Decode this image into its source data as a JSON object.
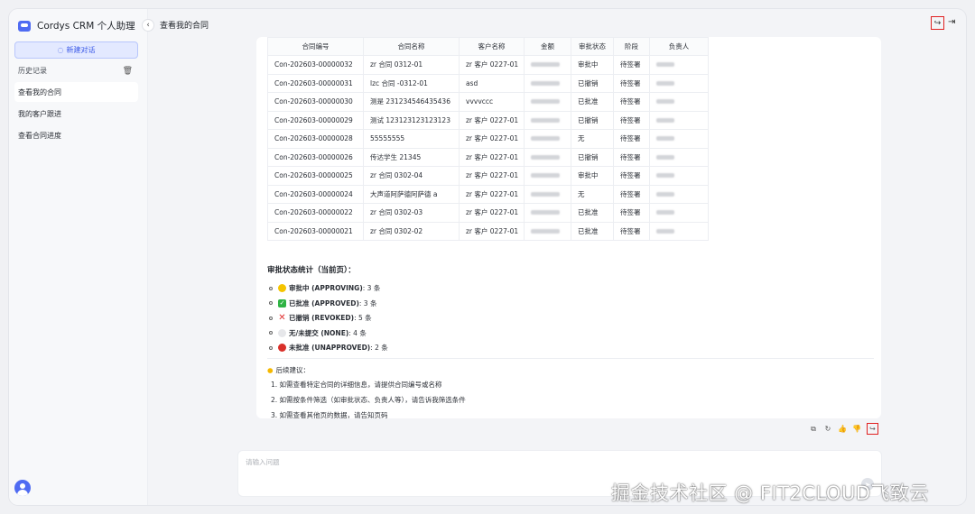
{
  "sidebar": {
    "app_name": "Cordys CRM 个人助理",
    "new_chat": "新建对话",
    "history_label": "历史记录",
    "items": [
      {
        "label": "查看我的合同",
        "active": true
      },
      {
        "label": "我的客户跟进",
        "active": false
      },
      {
        "label": "查看合同进度",
        "active": false
      }
    ]
  },
  "header": {
    "title": "查看我的合同"
  },
  "table": {
    "headers": [
      "合同编号",
      "合同名称",
      "客户名称",
      "金额",
      "审批状态",
      "阶段",
      "负责人"
    ],
    "rows": [
      [
        "Con-202603-00000032",
        "zr 合同 0312-01",
        "zr 客户 0227-01",
        "",
        "审批中",
        "待签署",
        ""
      ],
      [
        "Con-202603-00000031",
        "lzc 合同 -0312-01",
        "asd",
        "",
        "已撤销",
        "待签署",
        ""
      ],
      [
        "Con-202603-00000030",
        "测是 231234546435436",
        "vvvvccc",
        "",
        "已批准",
        "待签署",
        ""
      ],
      [
        "Con-202603-00000029",
        "测试 123123123123123",
        "zr 客户 0227-01",
        "",
        "已撤销",
        "待签署",
        ""
      ],
      [
        "Con-202603-00000028",
        "55555555",
        "zr 客户 0227-01",
        "",
        "无",
        "待签署",
        ""
      ],
      [
        "Con-202603-00000026",
        "传达学生 21345",
        "zr 客户 0227-01",
        "",
        "已撤销",
        "待签署",
        ""
      ],
      [
        "Con-202603-00000025",
        "zr 合同 0302-04",
        "zr 客户 0227-01",
        "",
        "审批中",
        "待签署",
        ""
      ],
      [
        "Con-202603-00000024",
        "大声道阿萨德阿萨德 a",
        "zr 客户 0227-01",
        "",
        "无",
        "待签署",
        ""
      ],
      [
        "Con-202603-00000022",
        "zr 合同 0302-03",
        "zr 客户 0227-01",
        "",
        "已批准",
        "待签署",
        ""
      ],
      [
        "Con-202603-00000021",
        "zr 合同 0302-02",
        "zr 客户 0227-01",
        "",
        "已批准",
        "待签署",
        ""
      ]
    ]
  },
  "stats": {
    "title": "审批状态统计（当前页）：",
    "items": [
      {
        "label": "审批中 (APPROVING)",
        "value": ": 3 条",
        "color": "#f5c400"
      },
      {
        "label": "已批准 (APPROVED)",
        "value": ": 3 条",
        "color": "#2fb344"
      },
      {
        "label": "已撤销 (REVOKED)",
        "value": ": 5 条",
        "color": "#e03131"
      },
      {
        "label": "无/未提交 (NONE)",
        "value": ": 4 条",
        "color": "#e6e7ea"
      },
      {
        "label": "未批准 (UNAPPROVED)",
        "value": ": 2 条",
        "color": "#d9302a"
      }
    ]
  },
  "advice": {
    "title": "后续建议：",
    "items": [
      "1. 如需查看特定合同的详细信息，请提供合同编号或名称",
      "2. 如需按条件筛选（如审批状态、负责人等），请告诉我筛选条件",
      "3. 如需查看其他页的数据，请告知页码"
    ]
  },
  "input": {
    "placeholder": "请输入问题"
  },
  "watermark": "掘金技术社区 @ FIT2CLOUD飞致云"
}
